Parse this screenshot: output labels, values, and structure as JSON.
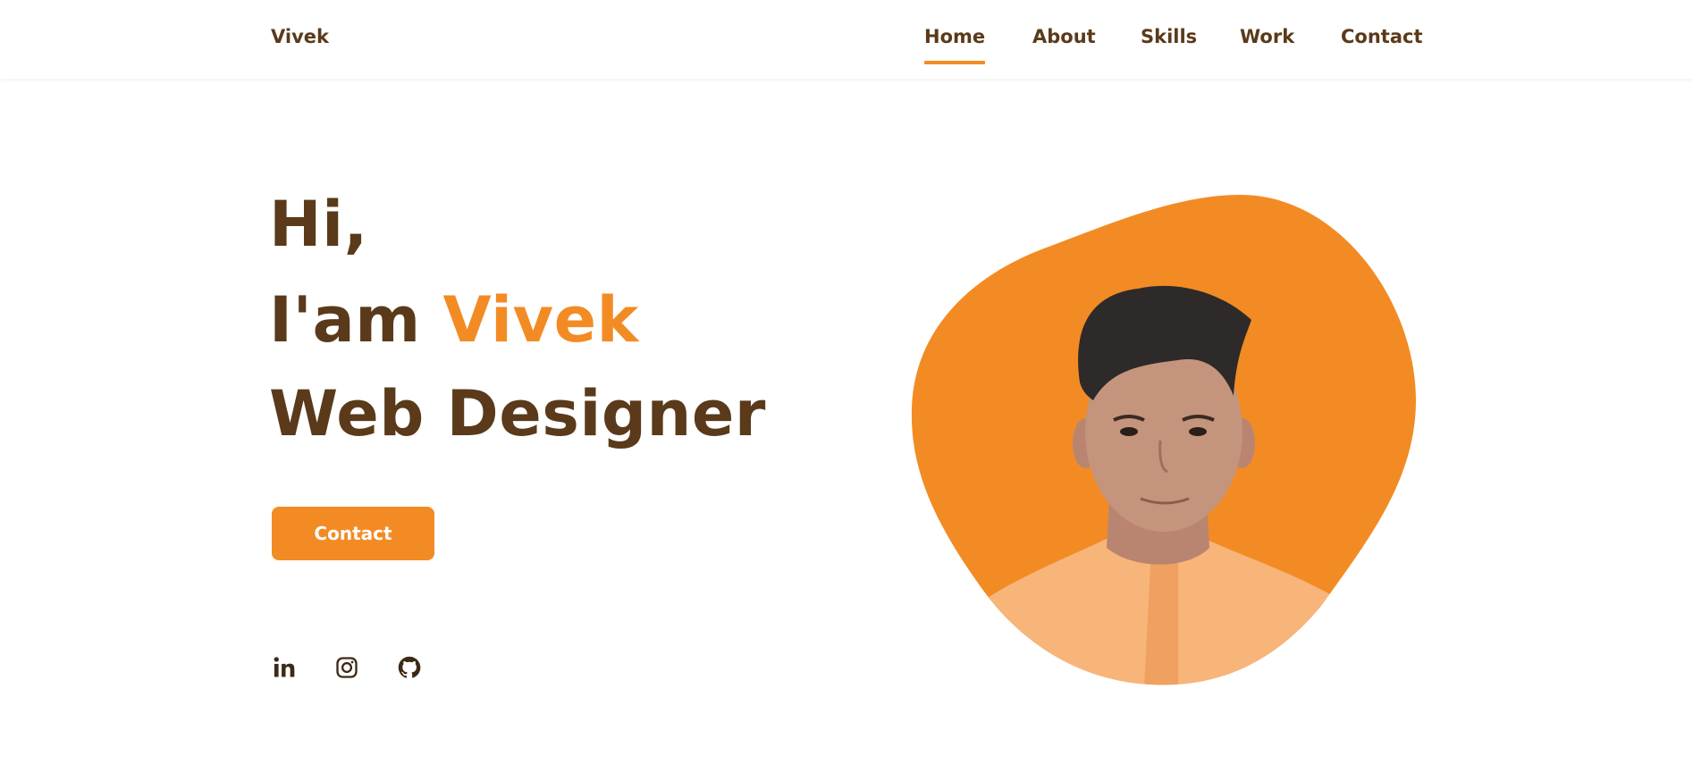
{
  "header": {
    "logo": "Vivek",
    "nav": [
      {
        "label": "Home",
        "active": true
      },
      {
        "label": "About",
        "active": false
      },
      {
        "label": "Skills",
        "active": false
      },
      {
        "label": "Work",
        "active": false
      },
      {
        "label": "Contact",
        "active": false
      }
    ]
  },
  "hero": {
    "greeting": "Hi,",
    "intro_prefix": "I'am ",
    "name": "Vivek",
    "role": "Web Designer",
    "cta_label": "Contact"
  },
  "social": [
    {
      "icon": "linkedin-icon"
    },
    {
      "icon": "instagram-icon"
    },
    {
      "icon": "github-icon"
    }
  ],
  "colors": {
    "accent": "#f38b24",
    "text": "#5a3a1a",
    "shirt": "#f7b57a",
    "hair": "#2e2a2a",
    "skin": "#c4957c"
  }
}
